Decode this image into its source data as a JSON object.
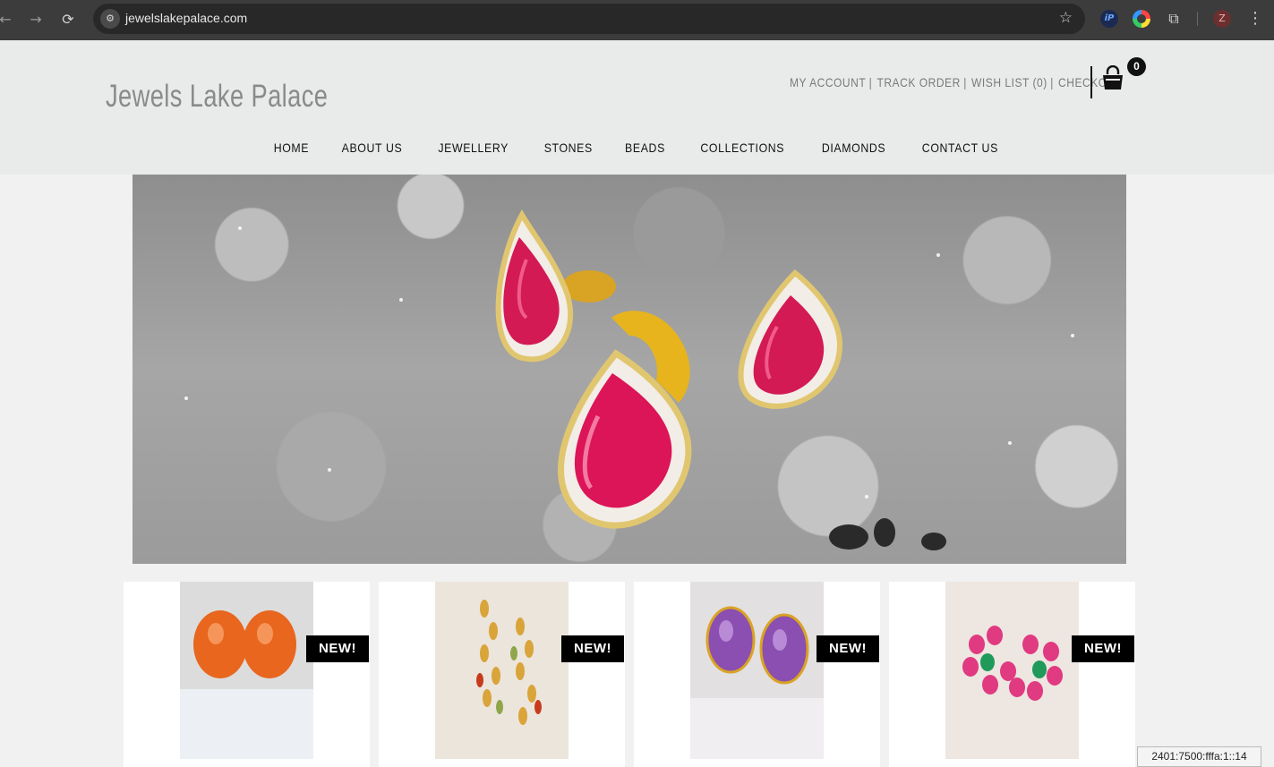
{
  "browser": {
    "url": "jewelslakepalace.com",
    "back_icon": "←",
    "forward_icon": "→",
    "reload_icon": "⟳",
    "site_info_icon": "⚙",
    "star_icon": "☆",
    "ext_ip_label": "iP",
    "puzzle_icon": "⧉",
    "profile_initial": "Z",
    "menu_icon": "⋮"
  },
  "header": {
    "logo": "Jewels Lake Palace",
    "top_links": [
      {
        "label": "MY ACCOUNT"
      },
      {
        "label": "TRACK ORDER"
      },
      {
        "label": "WISH LIST (0)"
      },
      {
        "label": "CHECKOUT"
      }
    ],
    "separator": "|",
    "cart_count": "0"
  },
  "nav": {
    "items": [
      {
        "label": "HOME"
      },
      {
        "label": "ABOUT US"
      },
      {
        "label": "JEWELLERY"
      },
      {
        "label": "STONES"
      },
      {
        "label": "BEADS"
      },
      {
        "label": "COLLECTIONS"
      },
      {
        "label": "DIAMONDS"
      },
      {
        "label": "CONTACT US"
      }
    ]
  },
  "hero": {
    "subject": "ruby and diamond pear earrings and pendant on crystal"
  },
  "products": [
    {
      "badge": "NEW!",
      "thumb_color": "#e8661e"
    },
    {
      "badge": "NEW!",
      "thumb_color": "#d9a43a"
    },
    {
      "badge": "NEW!",
      "thumb_color": "#8a4fb0"
    },
    {
      "badge": "NEW!",
      "thumb_color": "#e03a80"
    }
  ],
  "status_tooltip": "2401:7500:fffa:1::14"
}
